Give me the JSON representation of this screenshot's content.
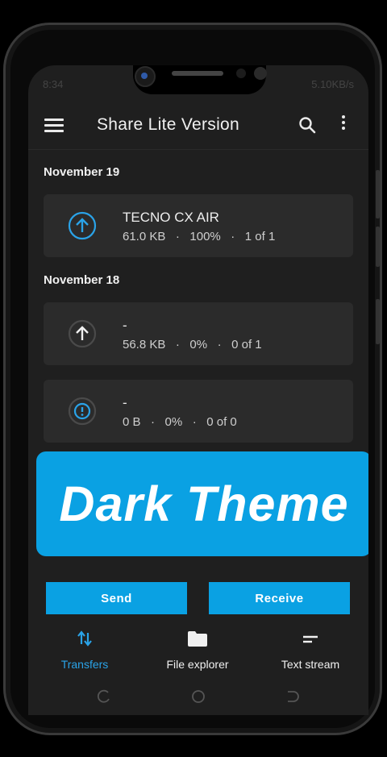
{
  "status_bar": {
    "time": "8:34",
    "right": "5.10KB/s"
  },
  "app_bar": {
    "title": "Share Lite Version"
  },
  "sections": [
    {
      "date": "November 19",
      "items": [
        {
          "name": "TECNO CX AIR",
          "size": "61.0 KB",
          "percent": "100%",
          "count": "1 of 1",
          "icon": "upload-arrow-icon"
        }
      ]
    },
    {
      "date": "November 18",
      "items": [
        {
          "name": "-",
          "size": "56.8 KB",
          "percent": "0%",
          "count": "0 of 1",
          "icon": "upload-arrow-icon"
        },
        {
          "name": "-",
          "size": "0 B",
          "percent": "0%",
          "count": "0 of 0",
          "icon": "error-icon"
        }
      ]
    }
  ],
  "banner": {
    "text": "Dark Theme"
  },
  "actions": {
    "send": "Send",
    "receive": "Receive"
  },
  "bottom_nav": [
    {
      "label": "Transfers",
      "icon": "transfer-arrows-icon",
      "active": true
    },
    {
      "label": "File explorer",
      "icon": "folder-icon",
      "active": false
    },
    {
      "label": "Text stream",
      "icon": "text-lines-icon",
      "active": false
    }
  ],
  "colors": {
    "accent": "#0aa1e3",
    "background": "#1f1f1f",
    "card": "#2b2b2b",
    "nav_active": "#2aa3e8"
  }
}
